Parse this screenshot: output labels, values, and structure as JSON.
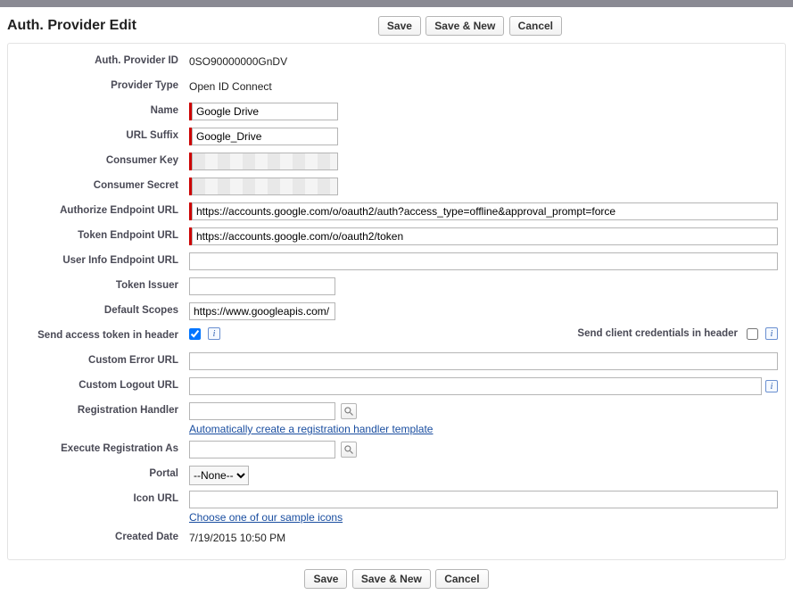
{
  "header": {
    "title": "Auth. Provider Edit",
    "buttons": {
      "save": "Save",
      "save_new": "Save & New",
      "cancel": "Cancel"
    }
  },
  "labels": {
    "auth_provider_id": "Auth. Provider ID",
    "provider_type": "Provider Type",
    "name": "Name",
    "url_suffix": "URL Suffix",
    "consumer_key": "Consumer Key",
    "consumer_secret": "Consumer Secret",
    "authorize_endpoint": "Authorize Endpoint URL",
    "token_endpoint": "Token Endpoint URL",
    "user_info_endpoint": "User Info Endpoint URL",
    "token_issuer": "Token Issuer",
    "default_scopes": "Default Scopes",
    "send_access_token": "Send access token in header",
    "send_client_creds": "Send client credentials in header",
    "custom_error_url": "Custom Error URL",
    "custom_logout_url": "Custom Logout URL",
    "registration_handler": "Registration Handler",
    "execute_registration_as": "Execute Registration As",
    "portal": "Portal",
    "icon_url": "Icon URL",
    "created_date": "Created Date"
  },
  "values": {
    "auth_provider_id": "0SO90000000GnDV",
    "provider_type": "Open ID Connect",
    "name": "Google Drive",
    "url_suffix": "Google_Drive",
    "authorize_endpoint": "https://accounts.google.com/o/oauth2/auth?access_type=offline&approval_prompt=force",
    "token_endpoint": "https://accounts.google.com/o/oauth2/token",
    "user_info_endpoint": "",
    "token_issuer": "",
    "default_scopes": "https://www.googleapis.com/",
    "custom_error_url": "",
    "custom_logout_url": "",
    "registration_handler": "",
    "execute_registration_as": "",
    "icon_url": "",
    "created_date": "7/19/2015 10:50 PM"
  },
  "links": {
    "auto_create_handler": "Automatically create a registration handler template",
    "choose_sample_icons": "Choose one of our sample icons"
  },
  "portal": {
    "selected": "--None--"
  }
}
